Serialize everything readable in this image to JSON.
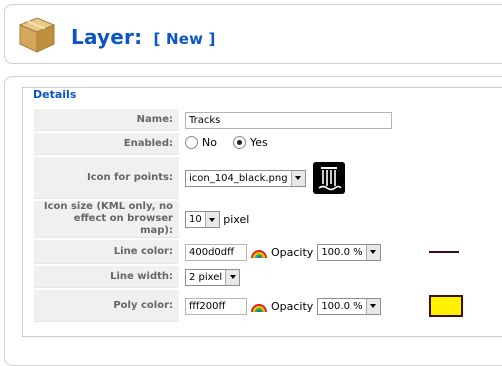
{
  "header": {
    "title": "Layer:",
    "subtitle": "[ New ]"
  },
  "details": {
    "legend": "Details",
    "fields": {
      "name": {
        "label": "Name:",
        "value": "Tracks"
      },
      "enabled": {
        "label": "Enabled:",
        "options": [
          "No",
          "Yes"
        ],
        "selected": "Yes"
      },
      "icon_for_points": {
        "label": "Icon for points:",
        "value": "icon_104_black.png"
      },
      "icon_size": {
        "label": "Icon size (KML only, no effect on browser map):",
        "value": "10",
        "unit": "pixel"
      },
      "line_color": {
        "label": "Line color:",
        "value": "400d0dff",
        "opacity_label": "Opacity",
        "opacity": "100.0 %",
        "swatch": "#400d0d"
      },
      "line_width": {
        "label": "Line width:",
        "value": "2 pixel"
      },
      "poly_color": {
        "label": "Poly color:",
        "value": "fff200ff",
        "opacity_label": "Opacity",
        "opacity": "100.0 %",
        "swatch": "#fff200"
      }
    }
  }
}
